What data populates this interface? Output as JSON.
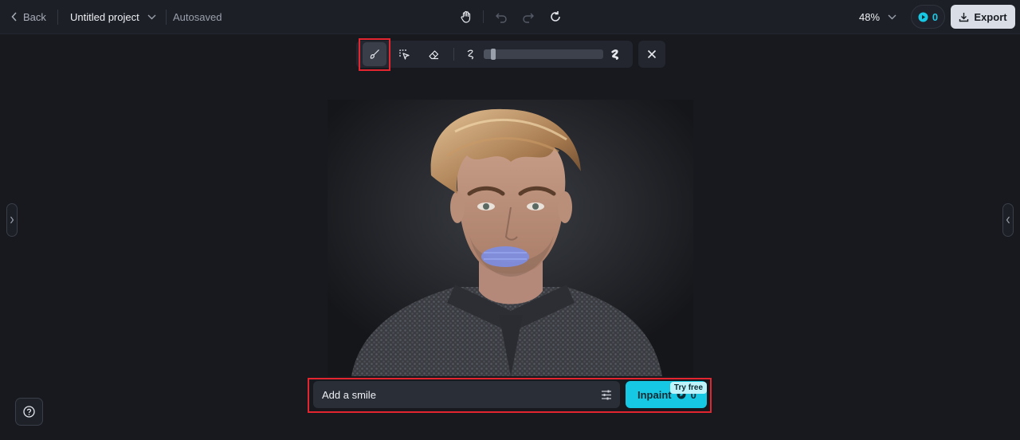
{
  "topbar": {
    "back_label": "Back",
    "project_title": "Untitled project",
    "autosave_status": "Autosaved",
    "zoom_level": "48%",
    "credits": "0",
    "export_label": "Export"
  },
  "toolbar": {
    "tools": [
      "brush-icon",
      "smart-select-icon",
      "eraser-icon"
    ],
    "brush_size_fraction": 0.08
  },
  "prompt": {
    "value": "Add a smile"
  },
  "inpaint": {
    "label": "Inpaint",
    "cost": "0",
    "badge": "Try free"
  },
  "colors": {
    "accent": "#17c8e4",
    "highlight": "#e3252f",
    "background": "#17191f"
  }
}
